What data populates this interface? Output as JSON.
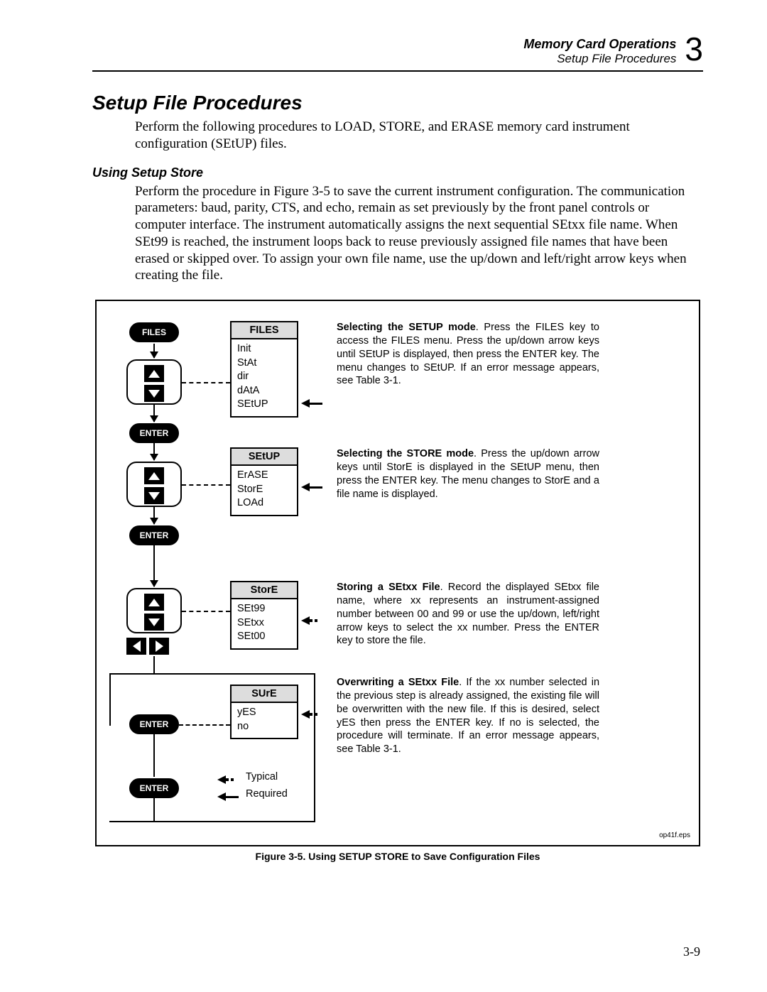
{
  "header": {
    "line1": "Memory Card Operations",
    "line2": "Setup File Procedures",
    "chapter_number": "3"
  },
  "section_title": "Setup File Procedures",
  "intro_paragraph": "Perform the following procedures to LOAD, STORE, and ERASE memory card instrument configuration (SEtUP) files.",
  "subheading": "Using Setup Store",
  "sub_paragraph": "Perform the procedure in Figure 3-5 to save the current instrument configuration. The communication parameters: baud, parity, CTS, and echo, remain as set previously by the front panel controls or computer interface. The instrument automatically assigns the next sequential SEtxx file name. When SEt99 is reached, the instrument loops back to reuse previously assigned file names that have been erased or skipped over. To assign your own file name, use the up/down and left/right arrow keys when creating the file.",
  "flowchart": {
    "keys": {
      "files": "FILES",
      "enter": "ENTER"
    },
    "menus": {
      "files": {
        "title": "FILES",
        "items": [
          "Init",
          "StAt",
          "dir",
          "dAtA",
          "SEtUP"
        ]
      },
      "setup": {
        "title": "SEtUP",
        "items": [
          "ErASE",
          "StorE",
          "LOAd"
        ]
      },
      "store": {
        "title": "StorE",
        "items": [
          "SEt99",
          "SEtxx",
          "SEt00"
        ]
      },
      "sure": {
        "title": "SUrE",
        "items": [
          "yES",
          "no"
        ]
      }
    },
    "descriptions": {
      "d1_bold": "Selecting the SETUP mode",
      "d1_text": ".  Press the FILES key to access the FILES menu.  Press the up/down arrow keys until SEtUP is displayed, then press the ENTER key.  The menu changes to SEtUP.  If an error message appears, see Table 3-1.",
      "d2_bold": "Selecting the STORE mode",
      "d2_text": ".  Press the up/down arrow keys until StorE is displayed in the SEtUP menu, then press the ENTER key.  The menu changes to StorE and a file name is displayed.",
      "d3_bold": "Storing a SEtxx File",
      "d3_text": ".  Record the displayed SEtxx file name, where xx represents an instrument-assigned number between 00 and 99 or use the up/down, left/right arrow keys to select the xx number.  Press the ENTER key to store the file.",
      "d4_bold": "Overwriting a SEtxx File",
      "d4_text": ".  If the xx number selected in the previous step is already assigned, the existing file will be overwritten with the new file.  If this is desired, select yES then press the ENTER key.  If no is selected, the procedure will terminate.  If an error message appears, see Table 3-1."
    },
    "legend": {
      "typical": "Typical",
      "required": "Required"
    }
  },
  "eps_label": "op41f.eps",
  "figure_caption": "Figure 3-5. Using SETUP STORE to Save Configuration Files",
  "page_number": "3-9"
}
